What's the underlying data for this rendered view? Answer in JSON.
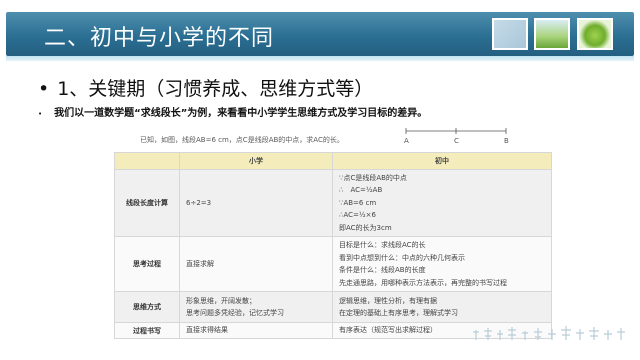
{
  "slide": {
    "title": "二、初中与小学的不同",
    "heading_bullet": "•",
    "heading": "1、关键期（习惯养成、思维方式等）",
    "subline_bullet": "•",
    "subline": "我们以一道数学题“求线段长”为例，来看看中小学学生思维方式及学习目标的差异。",
    "problem": "已知，如图，线段AB=6 cm，点C是线段AB的中点，求AC的长。",
    "diagram_labels": [
      "A",
      "C",
      "B"
    ]
  },
  "table": {
    "headers": [
      "",
      "小学",
      "初中"
    ],
    "rows": [
      {
        "label": "线段长度计算",
        "primary": [
          "6÷2=3"
        ],
        "middle": [
          "∵点C是线段AB的中点",
          "∴　AC=½AB",
          "∵AB=6 cm",
          "∴AC=½×6",
          "即AC的长为3cm"
        ]
      },
      {
        "label": "思考过程",
        "primary": [
          "直接求解"
        ],
        "middle": [
          "目标是什么：求线段AC的长",
          "看到中点想到什么：中点的六种几何表示",
          "条件是什么：线段AB的长度",
          "先走通思路，用哪种表示方法表示，再完整的书写过程"
        ]
      },
      {
        "label": "思维方式",
        "primary": [
          "形象思维，开阔发散；",
          "思考问题多凭经验，记忆式学习"
        ],
        "middle": [
          "逻辑思维，理性分析，有理有据",
          "在定理的基础上有序思考，理解式学习"
        ]
      },
      {
        "label": "过程书写",
        "primary": [
          "直接求得结果"
        ],
        "middle": [
          "有序表达（规范写出求解过程）"
        ]
      }
    ]
  },
  "colors": {
    "banner": "#2b6f93",
    "table_header": "#f4ecbb",
    "row_shade": "#f0f0f0"
  }
}
